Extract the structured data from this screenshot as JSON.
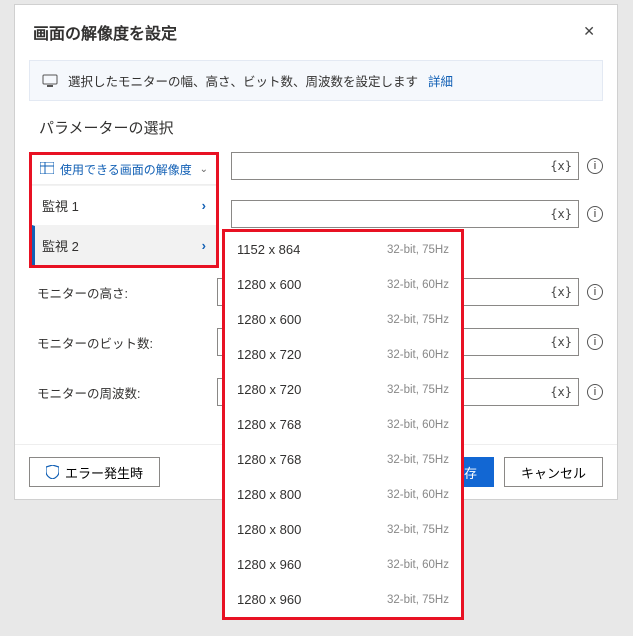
{
  "dialog": {
    "title": "画面の解像度を設定",
    "info_text": "選択したモニターの幅、高さ、ビット数、周波数を設定します",
    "info_link": "詳細",
    "section_title": "パラメーターの選択"
  },
  "sidebar": {
    "header": "使用できる画面の解像度",
    "items": [
      {
        "label": "監視 1"
      },
      {
        "label": "監視 2"
      }
    ]
  },
  "form": {
    "fx_label": "{x}",
    "height_label": "モニターの高さ:",
    "bits_label": "モニターのビット数:",
    "freq_label": "モニターの周波数:"
  },
  "dropdown": {
    "options": [
      {
        "res": "1152 x 864",
        "meta": "32-bit, 75Hz"
      },
      {
        "res": "1280 x 600",
        "meta": "32-bit, 60Hz"
      },
      {
        "res": "1280 x 600",
        "meta": "32-bit, 75Hz"
      },
      {
        "res": "1280 x 720",
        "meta": "32-bit, 60Hz"
      },
      {
        "res": "1280 x 720",
        "meta": "32-bit, 75Hz"
      },
      {
        "res": "1280 x 768",
        "meta": "32-bit, 60Hz"
      },
      {
        "res": "1280 x 768",
        "meta": "32-bit, 75Hz"
      },
      {
        "res": "1280 x 800",
        "meta": "32-bit, 60Hz"
      },
      {
        "res": "1280 x 800",
        "meta": "32-bit, 75Hz"
      },
      {
        "res": "1280 x 960",
        "meta": "32-bit, 60Hz"
      },
      {
        "res": "1280 x 960",
        "meta": "32-bit, 75Hz"
      }
    ]
  },
  "footer": {
    "error_button": "エラー発生時",
    "save_button": "保存",
    "save_button_visible": "存",
    "cancel_button": "キャンセル"
  }
}
